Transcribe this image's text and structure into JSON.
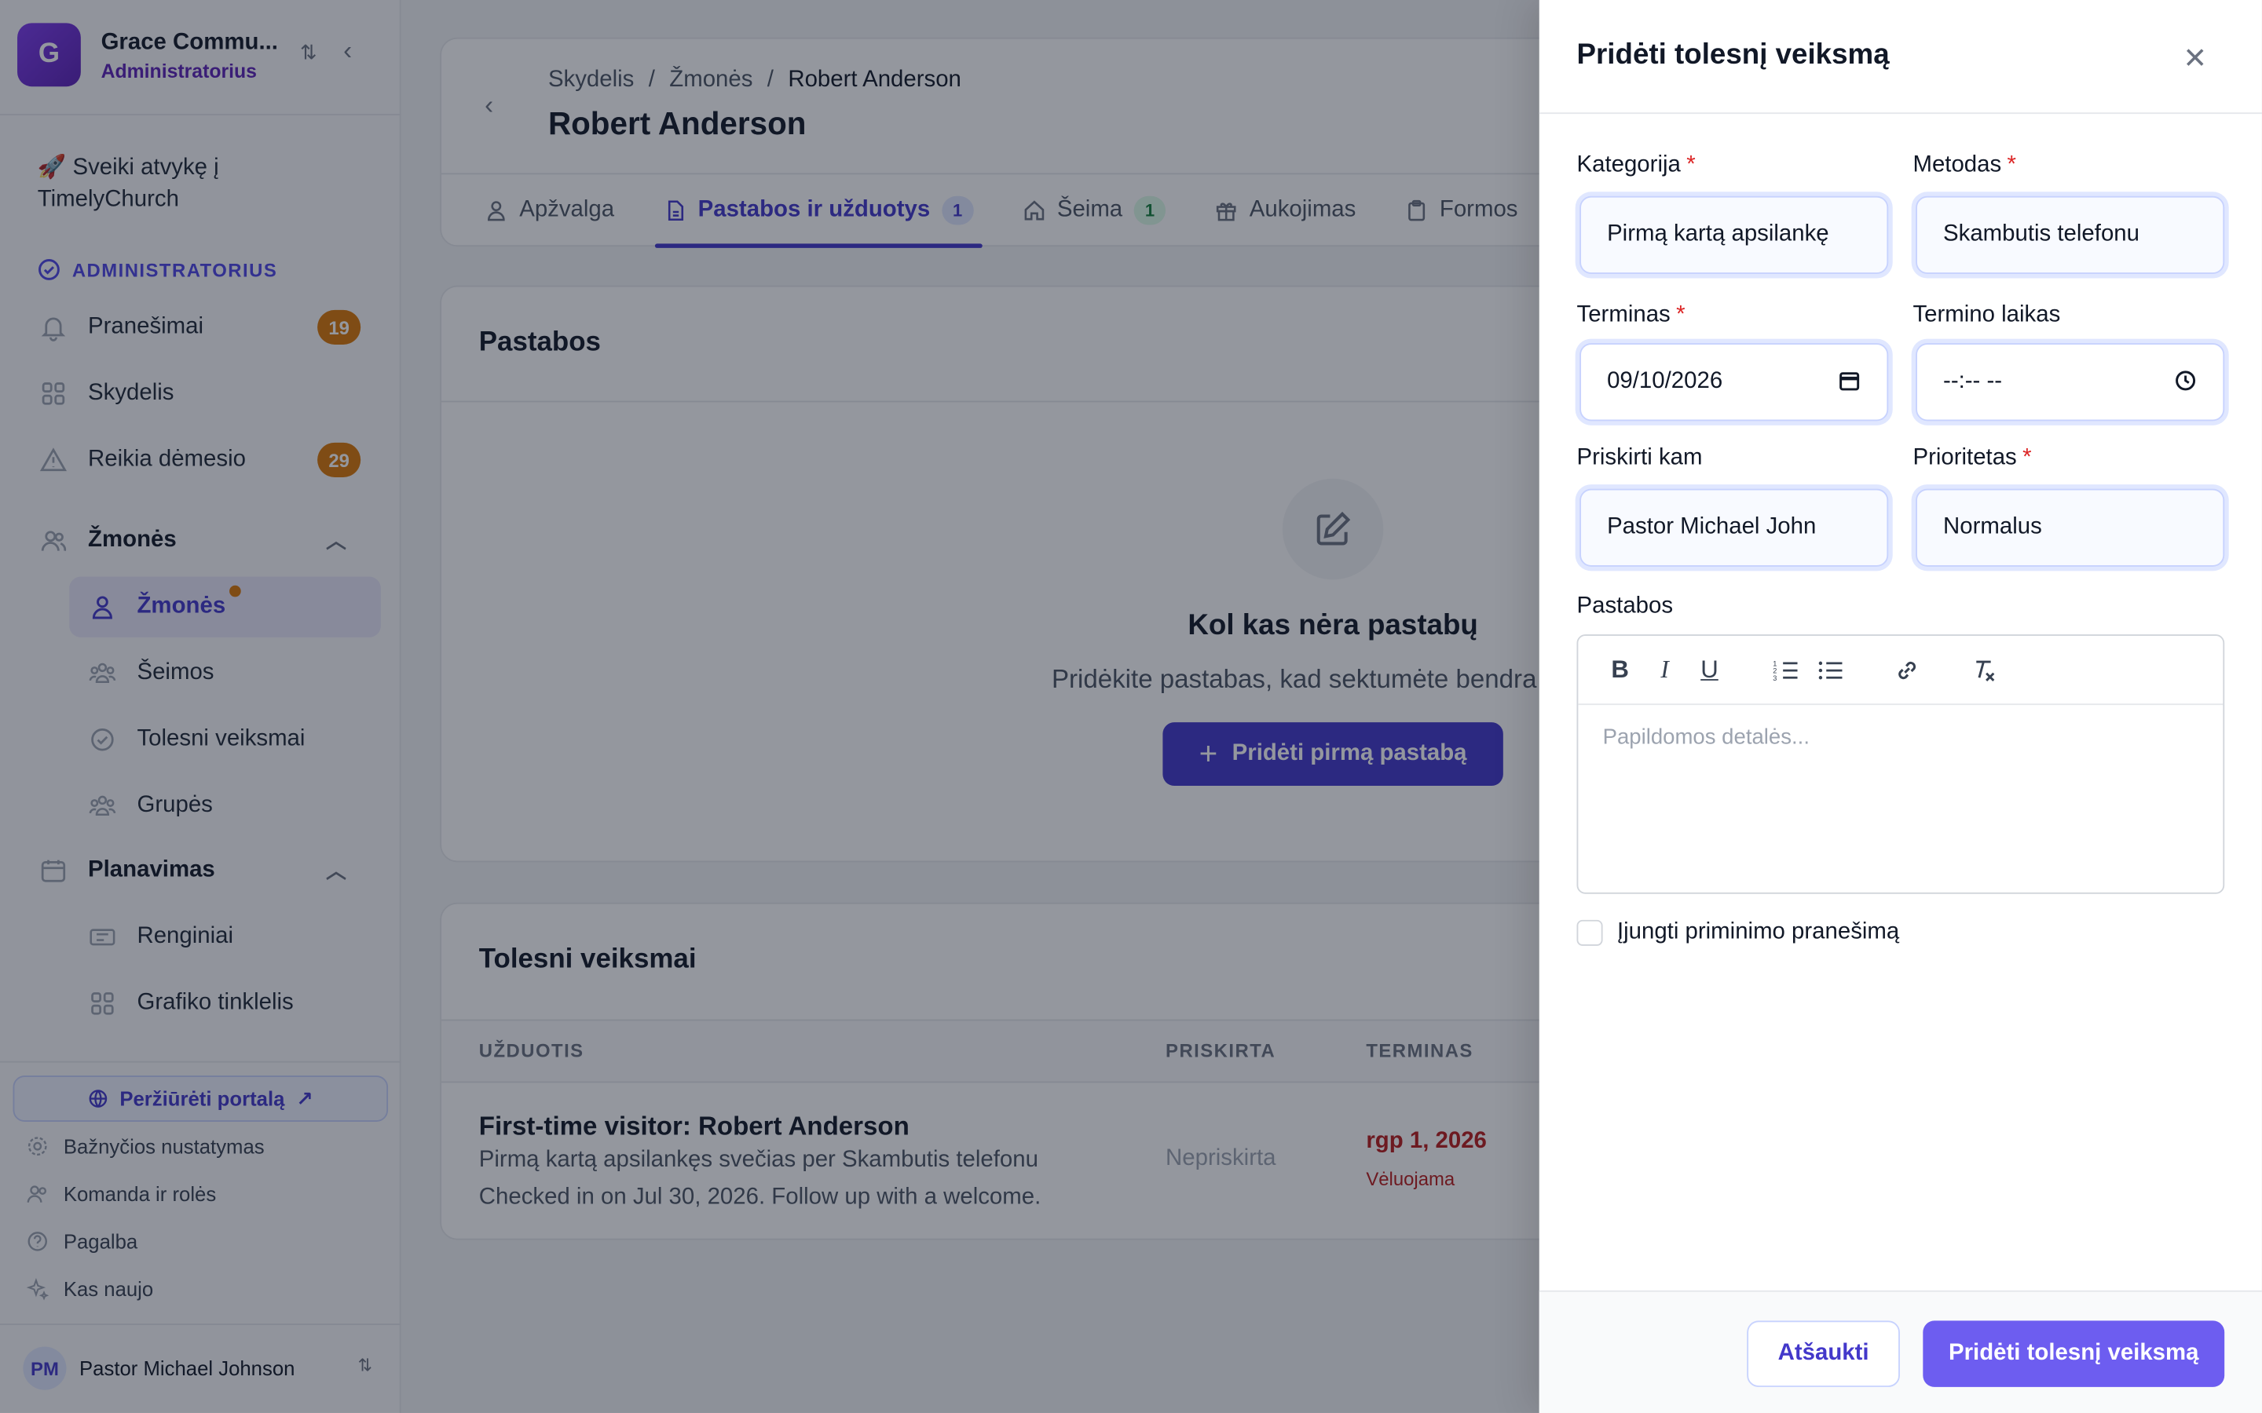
{
  "org": {
    "initial": "G",
    "name": "Grace Commu...",
    "role": "Administratorius"
  },
  "sidebar": {
    "welcome": "🚀 Sveiki atvykę į TimelyChurch",
    "admin_label": "ADMINISTRATORIUS",
    "notifications": {
      "label": "Pranešimai",
      "count": "19"
    },
    "dashboard": "Skydelis",
    "attention": {
      "label": "Reikia dėmesio",
      "count": "29"
    },
    "people_group": "Žmonės",
    "people": "Žmonės",
    "families": "Šeimos",
    "followups": "Tolesni veiksmai",
    "groups": "Grupės",
    "planning_group": "Planavimas",
    "events": "Renginiai",
    "schedule_grid": "Grafiko tinklelis",
    "portal_button": "Peržiūrėti portalą",
    "church_settings": "Bažnyčios nustatymas",
    "team_roles": "Komanda ir rolės",
    "help": "Pagalba",
    "whats_new": "Kas naujo",
    "user": {
      "initials": "PM",
      "name": "Pastor Michael Johnson"
    }
  },
  "header": {
    "breadcrumbs": [
      "Skydelis",
      "Žmonės",
      "Robert Anderson"
    ],
    "title": "Robert Anderson",
    "tabs": [
      {
        "label": "Apžvalga"
      },
      {
        "label": "Pastabos ir užduotys",
        "count": "1"
      },
      {
        "label": "Šeima",
        "count": "1"
      },
      {
        "label": "Aukojimas"
      },
      {
        "label": "Formos"
      }
    ]
  },
  "notes": {
    "title": "Pastabos",
    "empty_title": "Kol kas nėra pastabų",
    "empty_subtitle": "Pridėkite pastabas, kad sektumėte bendra",
    "add_first": "Pridėti pirmą pastabą"
  },
  "followups_table": {
    "title": "Tolesni veiksmai",
    "columns": [
      "UŽDUOTIS",
      "PRISKIRTA",
      "TERMINAS"
    ],
    "rows": [
      {
        "title": "First-time visitor: Robert Anderson",
        "line1": "Pirmą kartą apsilankęs svečias per Skambutis telefonu",
        "line2": "Checked in on Jul 30, 2026. Follow up with a welcome.",
        "assignee": "Nepriskirta",
        "due": "rgp 1, 2026",
        "status": "Vėluojama"
      }
    ]
  },
  "drawer": {
    "title": "Pridėti tolesnį veiksmą",
    "category": {
      "label": "Kategorija",
      "value": "Pirmą kartą apsilankę"
    },
    "method": {
      "label": "Metodas",
      "value": "Skambutis telefonu"
    },
    "due_date": {
      "label": "Terminas",
      "value": "09/10/2026"
    },
    "due_time": {
      "label": "Termino laikas",
      "value": "--:-- --"
    },
    "assign_to": {
      "label": "Priskirti kam",
      "value": "Pastor Michael John"
    },
    "priority": {
      "label": "Prioritetas",
      "value": "Normalus"
    },
    "notes_label": "Pastabos",
    "notes_placeholder": "Papildomos detalės...",
    "reminder_label": "Įjungti priminimo pranešimą",
    "cancel": "Atšaukti",
    "submit": "Pridėti tolesnį veiksmą"
  },
  "colors": {
    "accent": "#4338ca",
    "primary_button": "#6d5df0",
    "badge": "#d97706",
    "overdue": "#b91c1c"
  }
}
